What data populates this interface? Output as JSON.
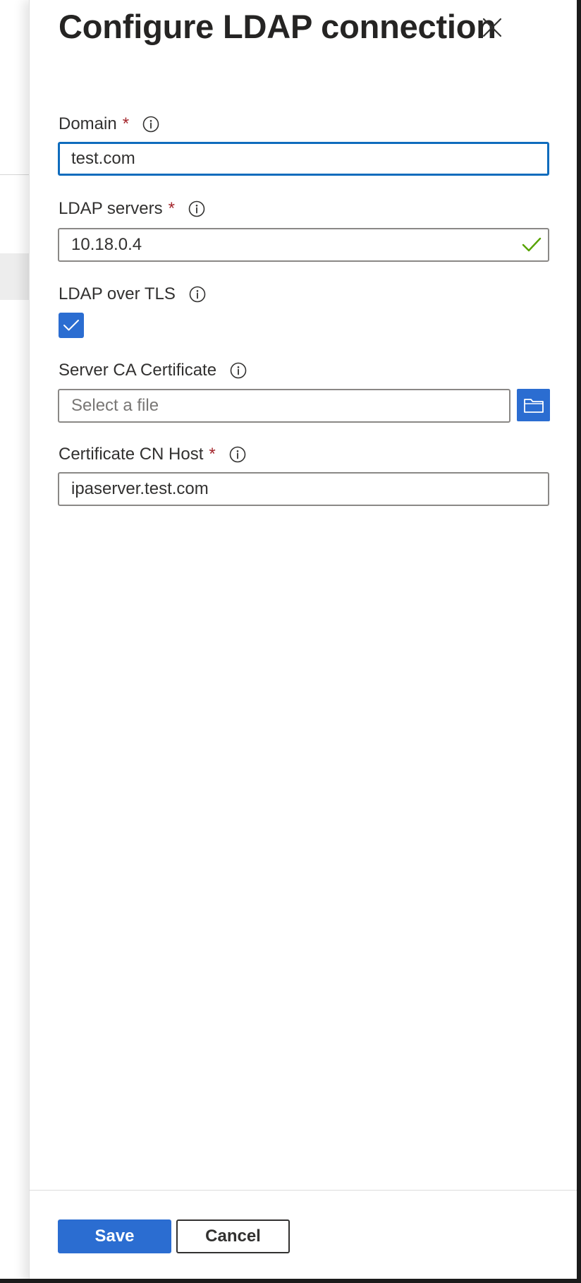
{
  "panel": {
    "title": "Configure LDAP connection",
    "close_label": "Close"
  },
  "fields": {
    "domain": {
      "label": "Domain",
      "required_mark": "*",
      "value": "test.com"
    },
    "ldap_servers": {
      "label": "LDAP servers",
      "required_mark": "*",
      "value": "10.18.0.4",
      "validation": "valid"
    },
    "ldap_over_tls": {
      "label": "LDAP over TLS",
      "checked": true
    },
    "server_ca_certificate": {
      "label": "Server CA Certificate",
      "placeholder": "Select a file"
    },
    "certificate_cn_host": {
      "label": "Certificate CN Host",
      "required_mark": "*",
      "value": "ipaserver.test.com"
    }
  },
  "footer": {
    "save_label": "Save",
    "cancel_label": "Cancel"
  },
  "icons": {
    "close": "close-icon",
    "info": "info-icon",
    "valid": "checkmark-icon",
    "checkbox": "checkbox-check-icon",
    "browse": "folder-icon"
  },
  "colors": {
    "primary": "#2b6dd1",
    "focus_border": "#0f6cbd",
    "required": "#a4262c",
    "valid": "#57a300",
    "text": "#323130"
  }
}
